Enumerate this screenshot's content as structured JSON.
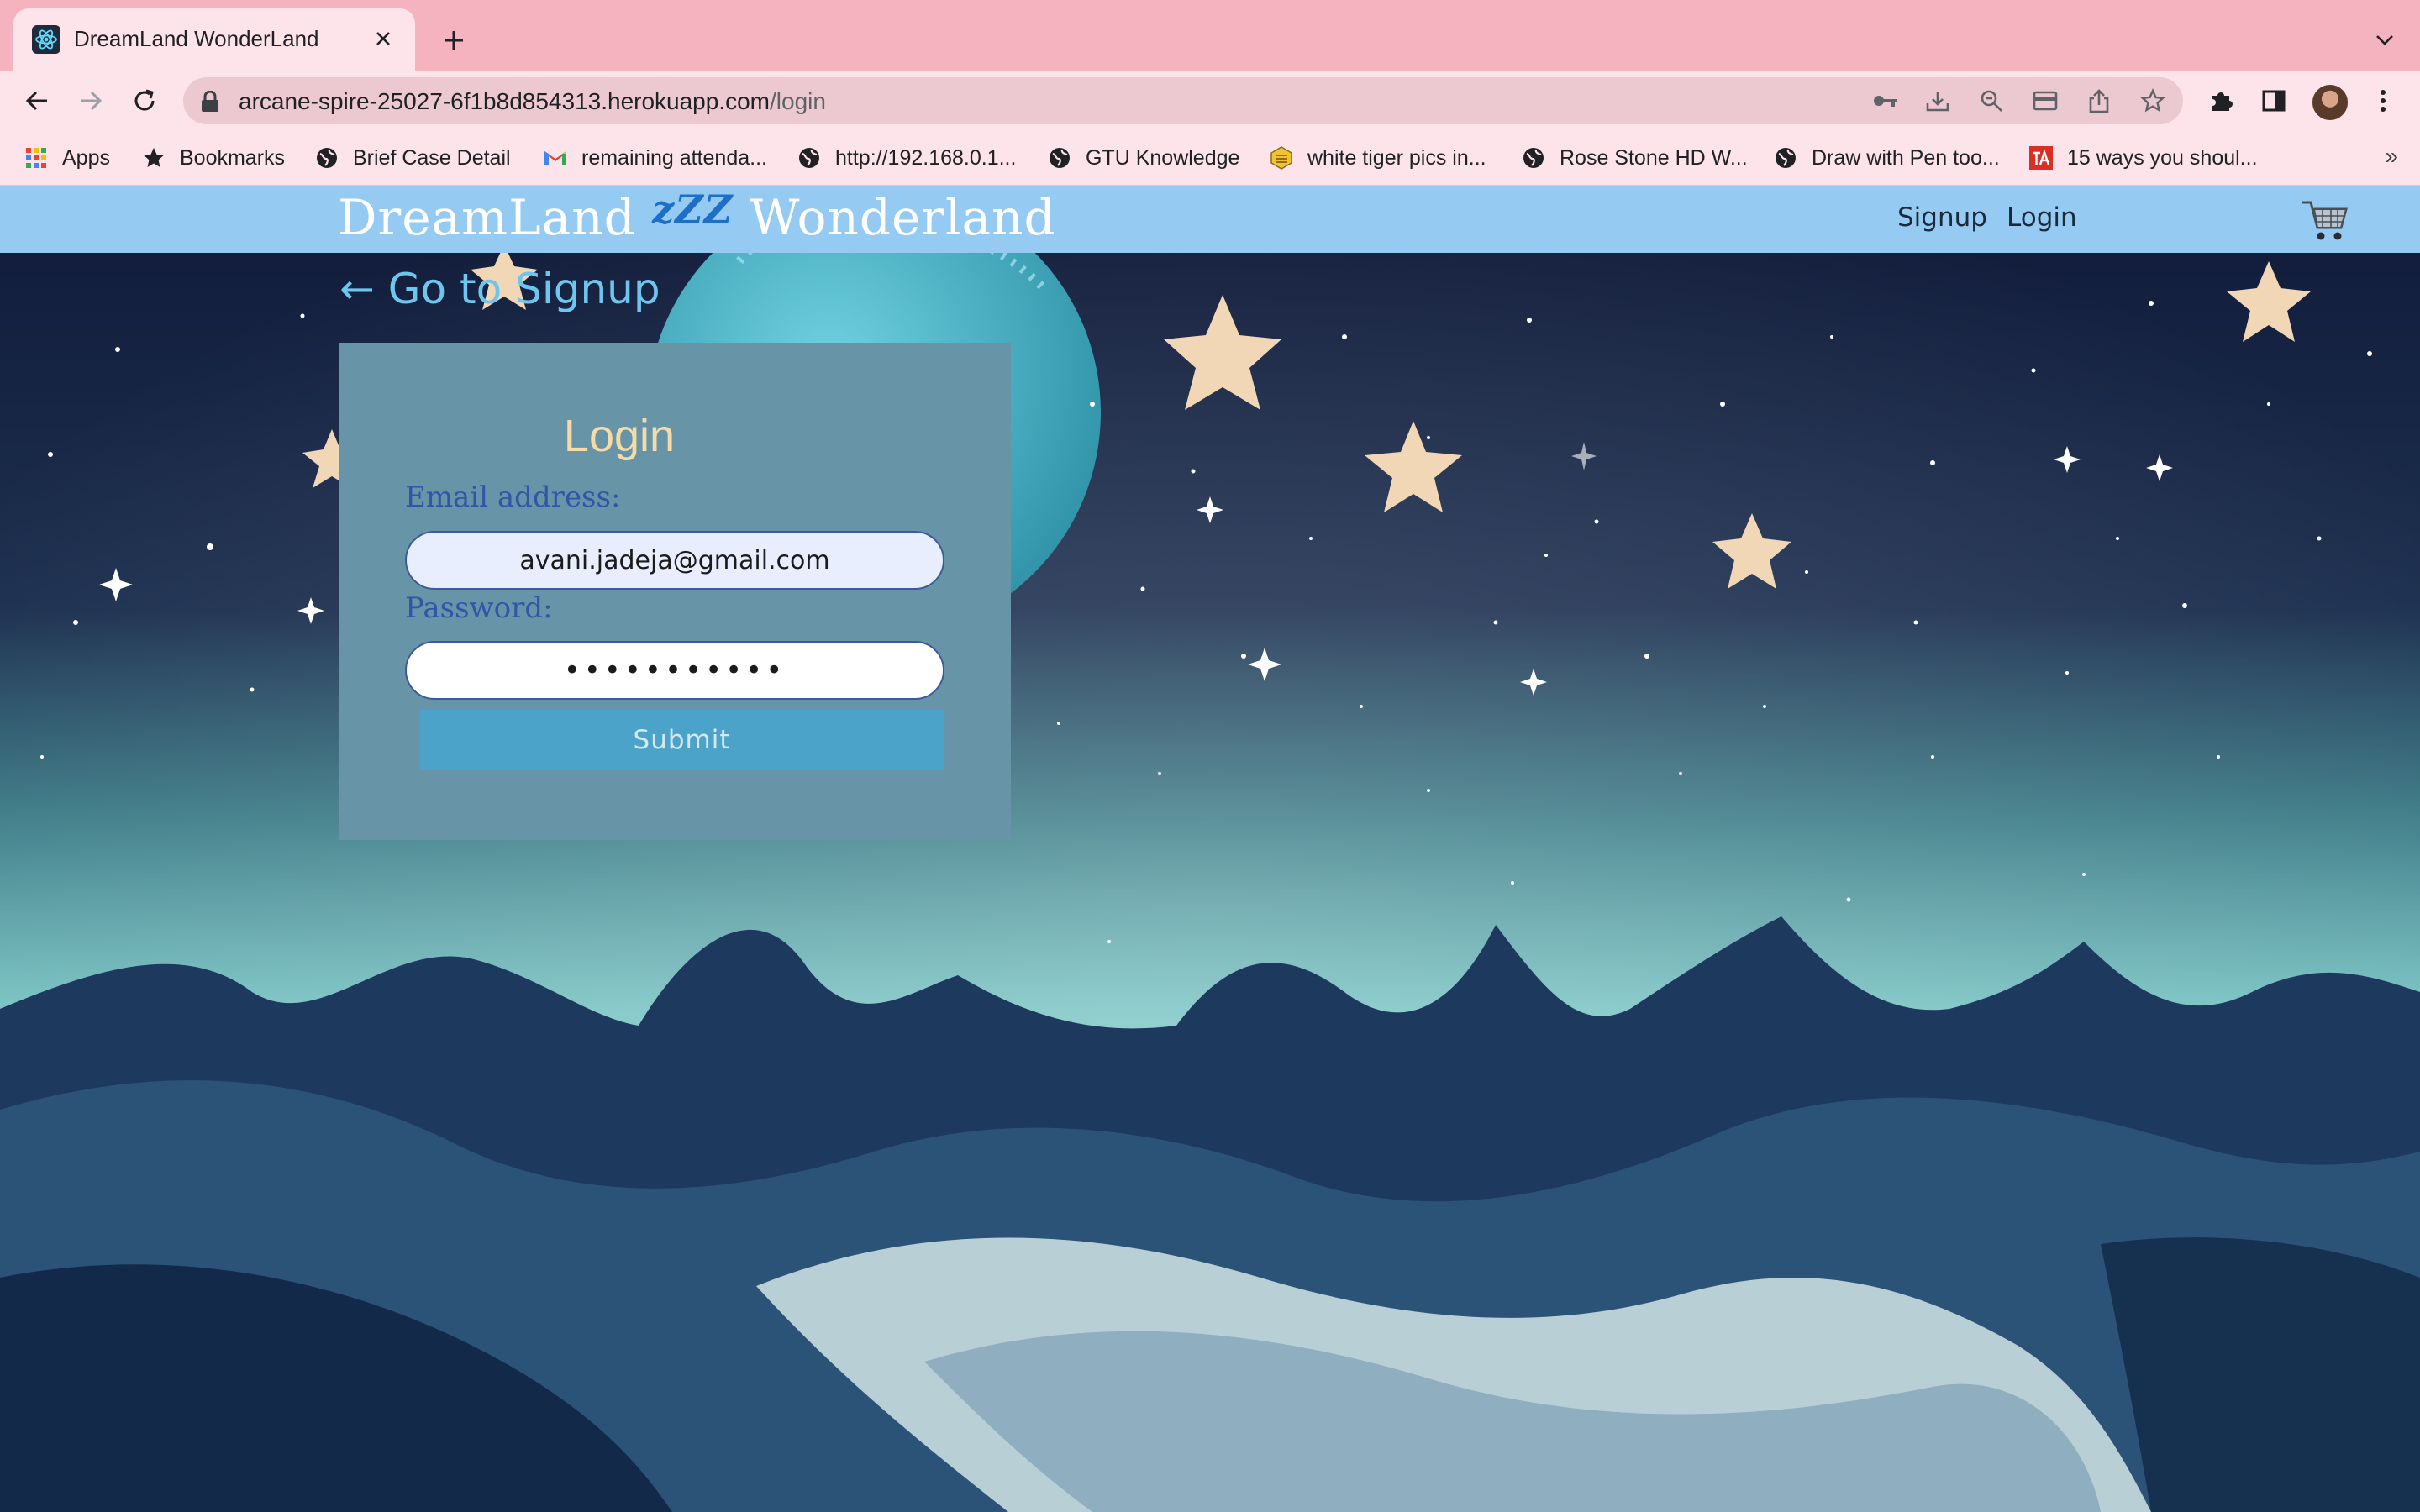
{
  "browser": {
    "tab_title": "DreamLand WonderLand",
    "url_host": "arcane-spire-25027-6f1b8d854313.herokuapp.com",
    "url_path": "/login",
    "bookmarks": [
      {
        "label": "Apps",
        "icon": "apps-grid-icon"
      },
      {
        "label": "Bookmarks",
        "icon": "star-icon"
      },
      {
        "label": "Brief Case Detail",
        "icon": "globe-icon"
      },
      {
        "label": "remaining attenda...",
        "icon": "gmail-icon"
      },
      {
        "label": "http://192.168.0.1...",
        "icon": "globe-icon"
      },
      {
        "label": "GTU Knowledge",
        "icon": "globe-icon"
      },
      {
        "label": "white tiger pics in...",
        "icon": "hexagon-icon"
      },
      {
        "label": "Rose Stone HD W...",
        "icon": "globe-icon"
      },
      {
        "label": "Draw with Pen too...",
        "icon": "globe-icon"
      },
      {
        "label": "15 ways you shoul...",
        "icon": "ta-icon"
      }
    ],
    "more_bookmarks": "»"
  },
  "navbar": {
    "brand_left": "DreamLand",
    "brand_zzz": "zZZ",
    "brand_right": "Wonderland",
    "links": [
      "Signup",
      "Login"
    ]
  },
  "back_link": "← Go to Signup",
  "login_form": {
    "title": "Login",
    "email_label": "Email address:",
    "email_value": "avani.jadeja@gmail.com",
    "password_label": "Password:",
    "password_value": "•••••••••••",
    "submit_label": "Submit"
  },
  "colors": {
    "tabstrip": "#f5b3c0",
    "navbar": "#95cbf2",
    "card": "#6795a7",
    "submit": "#4ba3c9",
    "title": "#f4dba8"
  }
}
